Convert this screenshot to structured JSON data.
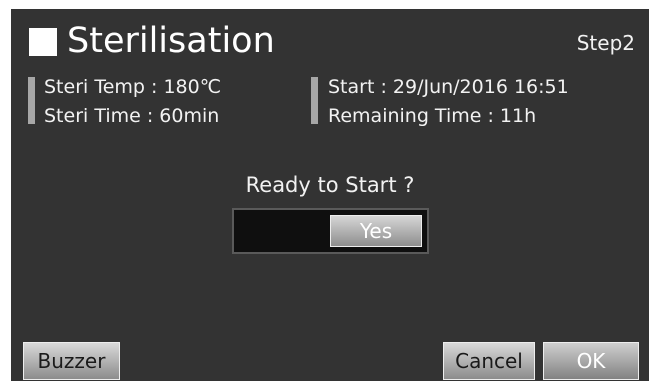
{
  "header": {
    "title": "Sterilisation",
    "step": "Step2"
  },
  "info": {
    "steri_temp": "Steri Temp :   180℃",
    "steri_time": "Steri Time  :   60min",
    "start": "Start :  29/Jun/2016 16:51",
    "remaining_time": "Remaining Time :        11h"
  },
  "prompt": "Ready to Start ?",
  "toggle": {
    "yes_label": "Yes"
  },
  "buttons": {
    "buzzer": "Buzzer",
    "cancel": "Cancel",
    "ok": "OK"
  }
}
